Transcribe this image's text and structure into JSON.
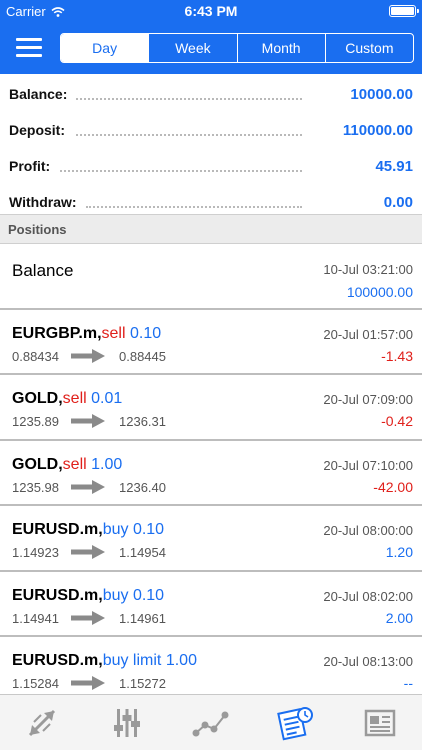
{
  "status_bar": {
    "carrier": "Carrier",
    "time": "6:43 PM"
  },
  "nav": {
    "segments": [
      {
        "label": "Day",
        "active": true
      },
      {
        "label": "Week",
        "active": false
      },
      {
        "label": "Month",
        "active": false
      },
      {
        "label": "Custom",
        "active": false
      }
    ]
  },
  "summary": {
    "balance_label": "Balance:",
    "balance_value": "10000.00",
    "deposit_label": "Deposit:",
    "deposit_value": "110000.00",
    "profit_label": "Profit:",
    "profit_value": "45.91",
    "withdraw_label": "Withdraw:",
    "withdraw_value": "0.00"
  },
  "section": {
    "title": "Positions"
  },
  "balance_entry": {
    "title": "Balance",
    "date": "10-Jul 03:21:00",
    "amount": "100000.00"
  },
  "positions": [
    {
      "symbol": "EURGBP.m,",
      "side": "sell",
      "volume": "0.10",
      "open": "0.88434",
      "close": "0.88445",
      "date": "20-Jul 01:57:00",
      "profit": "-1.43"
    },
    {
      "symbol": "GOLD,",
      "side": "sell",
      "volume": "0.01",
      "open": "1235.89",
      "close": "1236.31",
      "date": "20-Jul 07:09:00",
      "profit": "-0.42"
    },
    {
      "symbol": "GOLD,",
      "side": "sell",
      "volume": "1.00",
      "open": "1235.98",
      "close": "1236.40",
      "date": "20-Jul 07:10:00",
      "profit": "-42.00"
    },
    {
      "symbol": "EURUSD.m,",
      "side": "buy",
      "volume": "0.10",
      "open": "1.14923",
      "close": "1.14954",
      "date": "20-Jul 08:00:00",
      "profit": "1.20"
    },
    {
      "symbol": "EURUSD.m,",
      "side": "buy",
      "volume": "0.10",
      "open": "1.14941",
      "close": "1.14961",
      "date": "20-Jul 08:02:00",
      "profit": "2.00"
    },
    {
      "symbol": "EURUSD.m,",
      "side": "buy limit",
      "volume": "1.00",
      "open": "1.15284",
      "close": "1.15272",
      "date": "20-Jul 08:13:00",
      "profit": "--"
    }
  ],
  "colors": {
    "accent": "#1a6ef0",
    "negative": "#e0201b",
    "tab_icon": "#9a9a9a"
  },
  "tabs": [
    {
      "icon": "trade-arrows-icon",
      "active": false
    },
    {
      "icon": "sliders-icon",
      "active": false
    },
    {
      "icon": "chart-line-icon",
      "active": false
    },
    {
      "icon": "history-report-icon",
      "active": true
    },
    {
      "icon": "news-icon",
      "active": false
    }
  ]
}
